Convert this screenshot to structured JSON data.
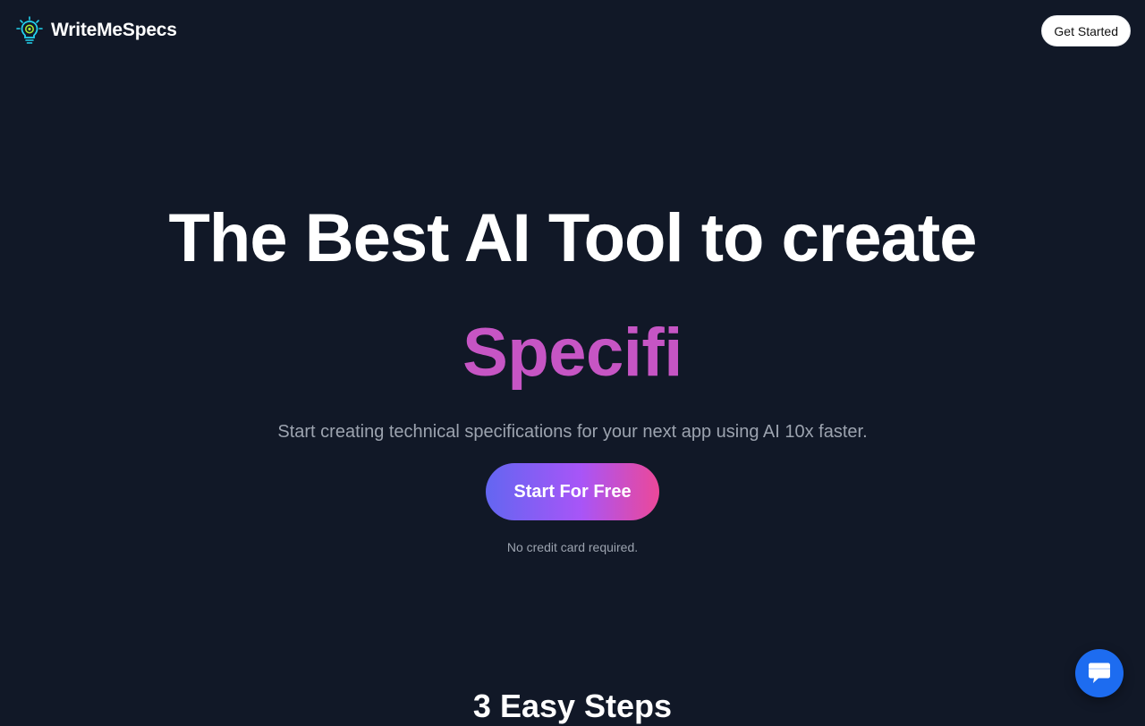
{
  "header": {
    "brand_name": "WriteMeSpecs",
    "brand_icon": "lightbulb-gear-icon",
    "get_started_label": "Get Started"
  },
  "hero": {
    "title": "The Best AI Tool to create",
    "typed_text": "Specifi",
    "subtitle": "Start creating technical specifications for your next app using AI 10x faster.",
    "cta_label": "Start For Free",
    "note": "No credit card required."
  },
  "steps": {
    "title": "3 Easy Steps"
  },
  "chat_widget": {
    "icon": "chat-bubble-icon"
  },
  "colors": {
    "background": "#111827",
    "accent_pink": "#c655c4",
    "cta_gradient_start": "#6366f1",
    "cta_gradient_end": "#ec4899",
    "chat_blue": "#1d6cf0"
  }
}
